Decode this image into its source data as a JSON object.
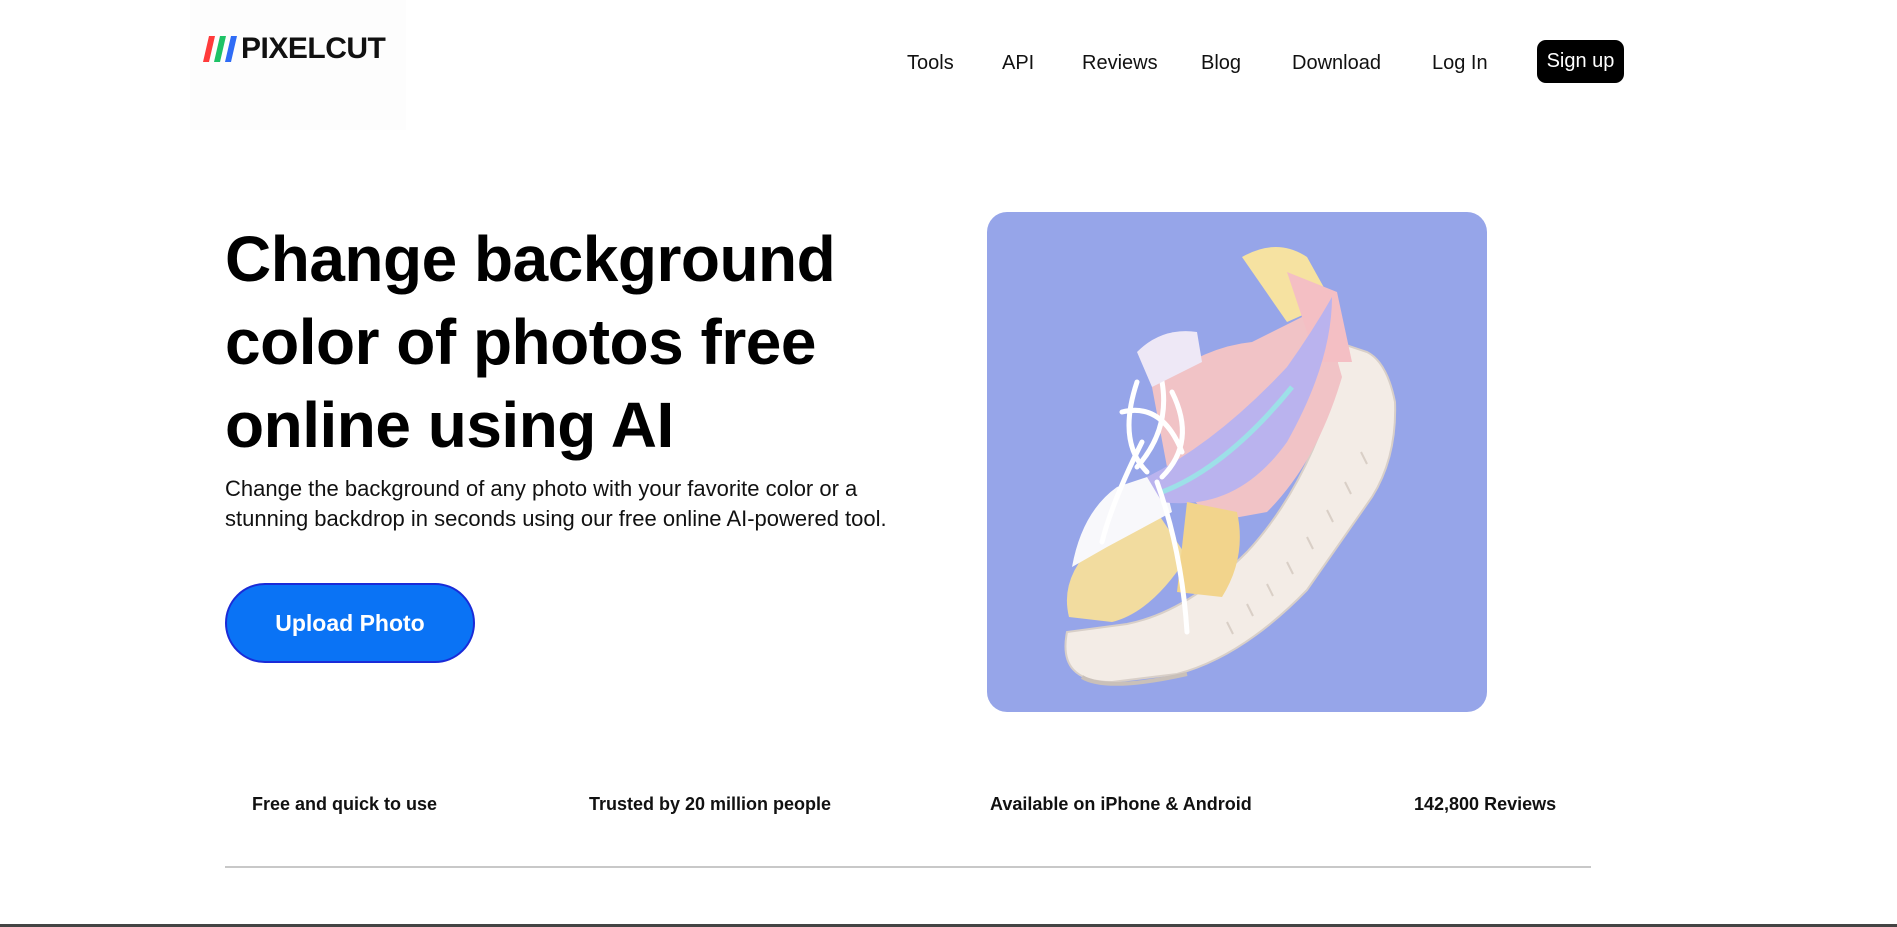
{
  "brand": {
    "name": "PIXELCUT",
    "stripe_colors": [
      "#ff3b3b",
      "#1ec266",
      "#2f6cf6"
    ]
  },
  "nav": {
    "links": [
      "Tools",
      "API",
      "Reviews",
      "Blog",
      "Download",
      "Log In"
    ],
    "signup_label": "Sign up"
  },
  "hero": {
    "title": "Change background color of photos free online using AI",
    "subtitle": "Change the background of any photo with your favorite color or a stunning backdrop in seconds using our free online AI-powered tool.",
    "cta_label": "Upload Photo",
    "image_bg": "#96a5e9",
    "cta_color": "#0a73f5"
  },
  "features": [
    "Free and quick to use",
    "Trusted by 20 million people",
    "Available on iPhone & Android",
    "142,800 Reviews"
  ]
}
